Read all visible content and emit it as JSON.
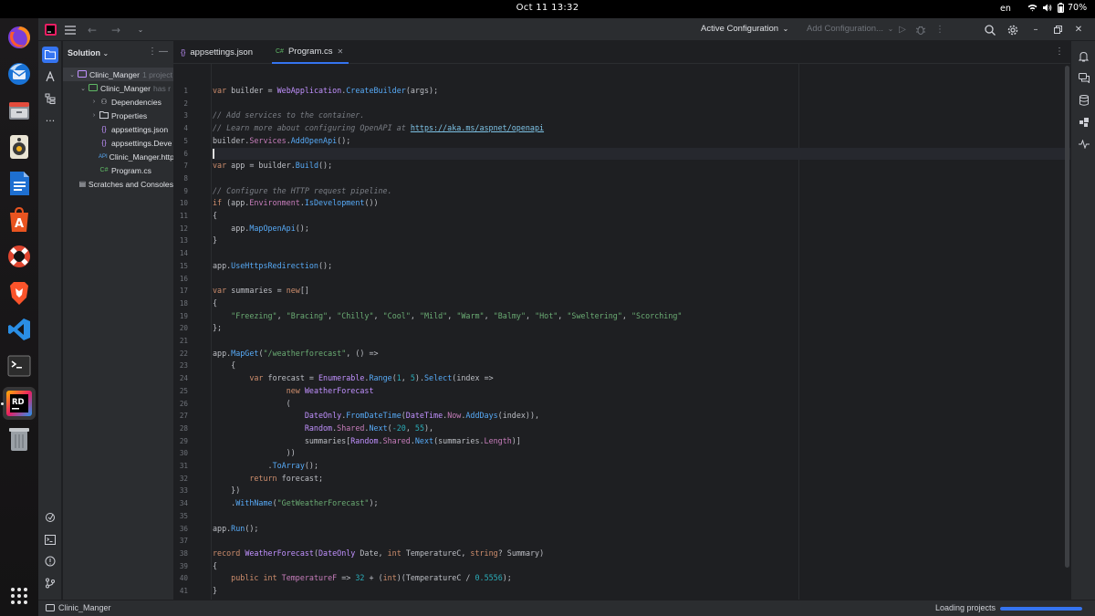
{
  "system": {
    "clock": "Oct 11  13:32",
    "language": "en",
    "battery": "70%"
  },
  "dock": {
    "apps": [
      "firefox-icon",
      "thunderbird-icon",
      "files-icon",
      "rhythmbox-icon",
      "writer-icon",
      "app-center-icon",
      "help-icon",
      "brave-icon",
      "vscode-icon",
      "terminal-icon",
      "rider-icon",
      "trash-icon",
      "app-grid-icon"
    ]
  },
  "toolbar": {
    "run_config": "Active Configuration",
    "add_config": "Add Configuration..."
  },
  "solution": {
    "header": "Solution",
    "items": [
      {
        "label": "Clinic_Manger",
        "hint": "1 project"
      },
      {
        "label": "Clinic_Manger",
        "hint": "has r"
      },
      {
        "label": "Dependencies"
      },
      {
        "label": "Properties"
      },
      {
        "label": "appsettings.json"
      },
      {
        "label": "appsettings.Deve"
      },
      {
        "label": "Clinic_Manger.http"
      },
      {
        "label": "Program.cs"
      },
      {
        "label": "Scratches and Consoles"
      }
    ]
  },
  "tabs": [
    {
      "label": "appsettings.json"
    },
    {
      "label": "Program.cs"
    }
  ],
  "editor": {
    "current_line": 6,
    "line_numbers": [
      "1",
      "2",
      "3",
      "4",
      "5",
      "6",
      "7",
      "8",
      "9",
      "10",
      "11",
      "12",
      "13",
      "14",
      "15",
      "16",
      "17",
      "18",
      "19",
      "20",
      "21",
      "22",
      "23",
      "24",
      "25",
      "26",
      "27",
      "28",
      "29",
      "30",
      "31",
      "32",
      "33",
      "34",
      "35",
      "36",
      "37",
      "38",
      "39",
      "40",
      "41"
    ],
    "lines": [
      [
        [
          "k",
          "var"
        ],
        [
          "p",
          " builder = "
        ],
        [
          "t",
          "WebApplication"
        ],
        [
          "p",
          "."
        ],
        [
          "m",
          "CreateBuilder"
        ],
        [
          "p",
          "(args);"
        ]
      ],
      [],
      [
        [
          "c",
          "// Add services to the container."
        ]
      ],
      [
        [
          "c",
          "// Learn more about configuring OpenAPI at "
        ],
        [
          "cl",
          "https://aka.ms/aspnet/openapi"
        ]
      ],
      [
        [
          "p",
          "builder."
        ],
        [
          "fld",
          "Services"
        ],
        [
          "p",
          "."
        ],
        [
          "m",
          "AddOpenApi"
        ],
        [
          "p",
          "();"
        ]
      ],
      [],
      [
        [
          "k",
          "var"
        ],
        [
          "p",
          " app = builder."
        ],
        [
          "m",
          "Build"
        ],
        [
          "p",
          "();"
        ]
      ],
      [],
      [
        [
          "c",
          "// Configure the HTTP request pipeline."
        ]
      ],
      [
        [
          "k",
          "if"
        ],
        [
          "p",
          " (app."
        ],
        [
          "fld",
          "Environment"
        ],
        [
          "p",
          "."
        ],
        [
          "m",
          "IsDevelopment"
        ],
        [
          "p",
          "())"
        ]
      ],
      [
        [
          "p",
          "{"
        ]
      ],
      [
        [
          "p",
          "    app."
        ],
        [
          "m",
          "MapOpenApi"
        ],
        [
          "p",
          "();"
        ]
      ],
      [
        [
          "p",
          "}"
        ]
      ],
      [],
      [
        [
          "p",
          "app."
        ],
        [
          "m",
          "UseHttpsRedirection"
        ],
        [
          "p",
          "();"
        ]
      ],
      [],
      [
        [
          "k",
          "var"
        ],
        [
          "p",
          " "
        ],
        [
          "v",
          "summaries"
        ],
        [
          "p",
          " = "
        ],
        [
          "k",
          "new"
        ],
        [
          "p",
          "[]"
        ]
      ],
      [
        [
          "p",
          "{"
        ]
      ],
      [
        [
          "s",
          "    \"Freezing\""
        ],
        [
          "p",
          ", "
        ],
        [
          "s",
          "\"Bracing\""
        ],
        [
          "p",
          ", "
        ],
        [
          "s",
          "\"Chilly\""
        ],
        [
          "p",
          ", "
        ],
        [
          "s",
          "\"Cool\""
        ],
        [
          "p",
          ", "
        ],
        [
          "s",
          "\"Mild\""
        ],
        [
          "p",
          ", "
        ],
        [
          "s",
          "\"Warm\""
        ],
        [
          "p",
          ", "
        ],
        [
          "s",
          "\"Balmy\""
        ],
        [
          "p",
          ", "
        ],
        [
          "s",
          "\"Hot\""
        ],
        [
          "p",
          ", "
        ],
        [
          "s",
          "\"Sweltering\""
        ],
        [
          "p",
          ", "
        ],
        [
          "s",
          "\"Scorching\""
        ]
      ],
      [
        [
          "p",
          "};"
        ]
      ],
      [],
      [
        [
          "p",
          "app."
        ],
        [
          "m",
          "MapGet"
        ],
        [
          "p",
          "("
        ],
        [
          "s",
          "\"/weatherforecast\""
        ],
        [
          "p",
          ", () =>"
        ]
      ],
      [
        [
          "p",
          "    {"
        ]
      ],
      [
        [
          "p",
          "        "
        ],
        [
          "k",
          "var"
        ],
        [
          "p",
          " forecast = "
        ],
        [
          "t",
          "Enumerable"
        ],
        [
          "p",
          "."
        ],
        [
          "m",
          "Range"
        ],
        [
          "p",
          "("
        ],
        [
          "n",
          "1"
        ],
        [
          "p",
          ", "
        ],
        [
          "n",
          "5"
        ],
        [
          "p",
          ")."
        ],
        [
          "m",
          "Select"
        ],
        [
          "p",
          "(index =>"
        ]
      ],
      [
        [
          "p",
          "                "
        ],
        [
          "k",
          "new"
        ],
        [
          "p",
          " "
        ],
        [
          "t",
          "WeatherForecast"
        ]
      ],
      [
        [
          "p",
          "                ("
        ]
      ],
      [
        [
          "p",
          "                    "
        ],
        [
          "t",
          "DateOnly"
        ],
        [
          "p",
          "."
        ],
        [
          "m",
          "FromDateTime"
        ],
        [
          "p",
          "("
        ],
        [
          "t",
          "DateTime"
        ],
        [
          "p",
          "."
        ],
        [
          "fld",
          "Now"
        ],
        [
          "p",
          "."
        ],
        [
          "m",
          "AddDays"
        ],
        [
          "p",
          "(index)),"
        ]
      ],
      [
        [
          "p",
          "                    "
        ],
        [
          "t",
          "Random"
        ],
        [
          "p",
          "."
        ],
        [
          "fld",
          "Shared"
        ],
        [
          "p",
          "."
        ],
        [
          "m",
          "Next"
        ],
        [
          "p",
          "("
        ],
        [
          "n",
          "-20"
        ],
        [
          "p",
          ", "
        ],
        [
          "n",
          "55"
        ],
        [
          "p",
          "),"
        ]
      ],
      [
        [
          "p",
          "                    summaries["
        ],
        [
          "t",
          "Random"
        ],
        [
          "p",
          "."
        ],
        [
          "fld",
          "Shared"
        ],
        [
          "p",
          "."
        ],
        [
          "m",
          "Next"
        ],
        [
          "p",
          "(summaries."
        ],
        [
          "fld",
          "Length"
        ],
        [
          "p",
          ")]"
        ]
      ],
      [
        [
          "p",
          "                ))"
        ]
      ],
      [
        [
          "p",
          "            ."
        ],
        [
          "m",
          "ToArray"
        ],
        [
          "p",
          "();"
        ]
      ],
      [
        [
          "p",
          "        "
        ],
        [
          "k",
          "return"
        ],
        [
          "p",
          " forecast;"
        ]
      ],
      [
        [
          "p",
          "    })"
        ]
      ],
      [
        [
          "p",
          "    ."
        ],
        [
          "m",
          "WithName"
        ],
        [
          "p",
          "("
        ],
        [
          "s",
          "\"GetWeatherForecast\""
        ],
        [
          "p",
          ");"
        ]
      ],
      [],
      [
        [
          "p",
          "app."
        ],
        [
          "m",
          "Run"
        ],
        [
          "p",
          "();"
        ]
      ],
      [],
      [
        [
          "k",
          "record"
        ],
        [
          "p",
          " "
        ],
        [
          "t",
          "WeatherForecast"
        ],
        [
          "p",
          "("
        ],
        [
          "t",
          "DateOnly"
        ],
        [
          "p",
          " Date, "
        ],
        [
          "k",
          "int"
        ],
        [
          "p",
          " TemperatureC, "
        ],
        [
          "k",
          "string"
        ],
        [
          "p",
          "? Summary)"
        ]
      ],
      [
        [
          "p",
          "{"
        ]
      ],
      [
        [
          "p",
          "    "
        ],
        [
          "k",
          "public"
        ],
        [
          "p",
          " "
        ],
        [
          "k",
          "int"
        ],
        [
          "p",
          " "
        ],
        [
          "fld",
          "TemperatureF"
        ],
        [
          "p",
          " => "
        ],
        [
          "n",
          "32"
        ],
        [
          "p",
          " + ("
        ],
        [
          "k",
          "int"
        ],
        [
          "p",
          ")(TemperatureC / "
        ],
        [
          "n",
          "0.5556"
        ],
        [
          "p",
          ");"
        ]
      ],
      [
        [
          "p",
          "}"
        ]
      ]
    ]
  },
  "status": {
    "project": "Clinic_Manger",
    "loading": "Loading projects",
    "progress": 1.0
  }
}
